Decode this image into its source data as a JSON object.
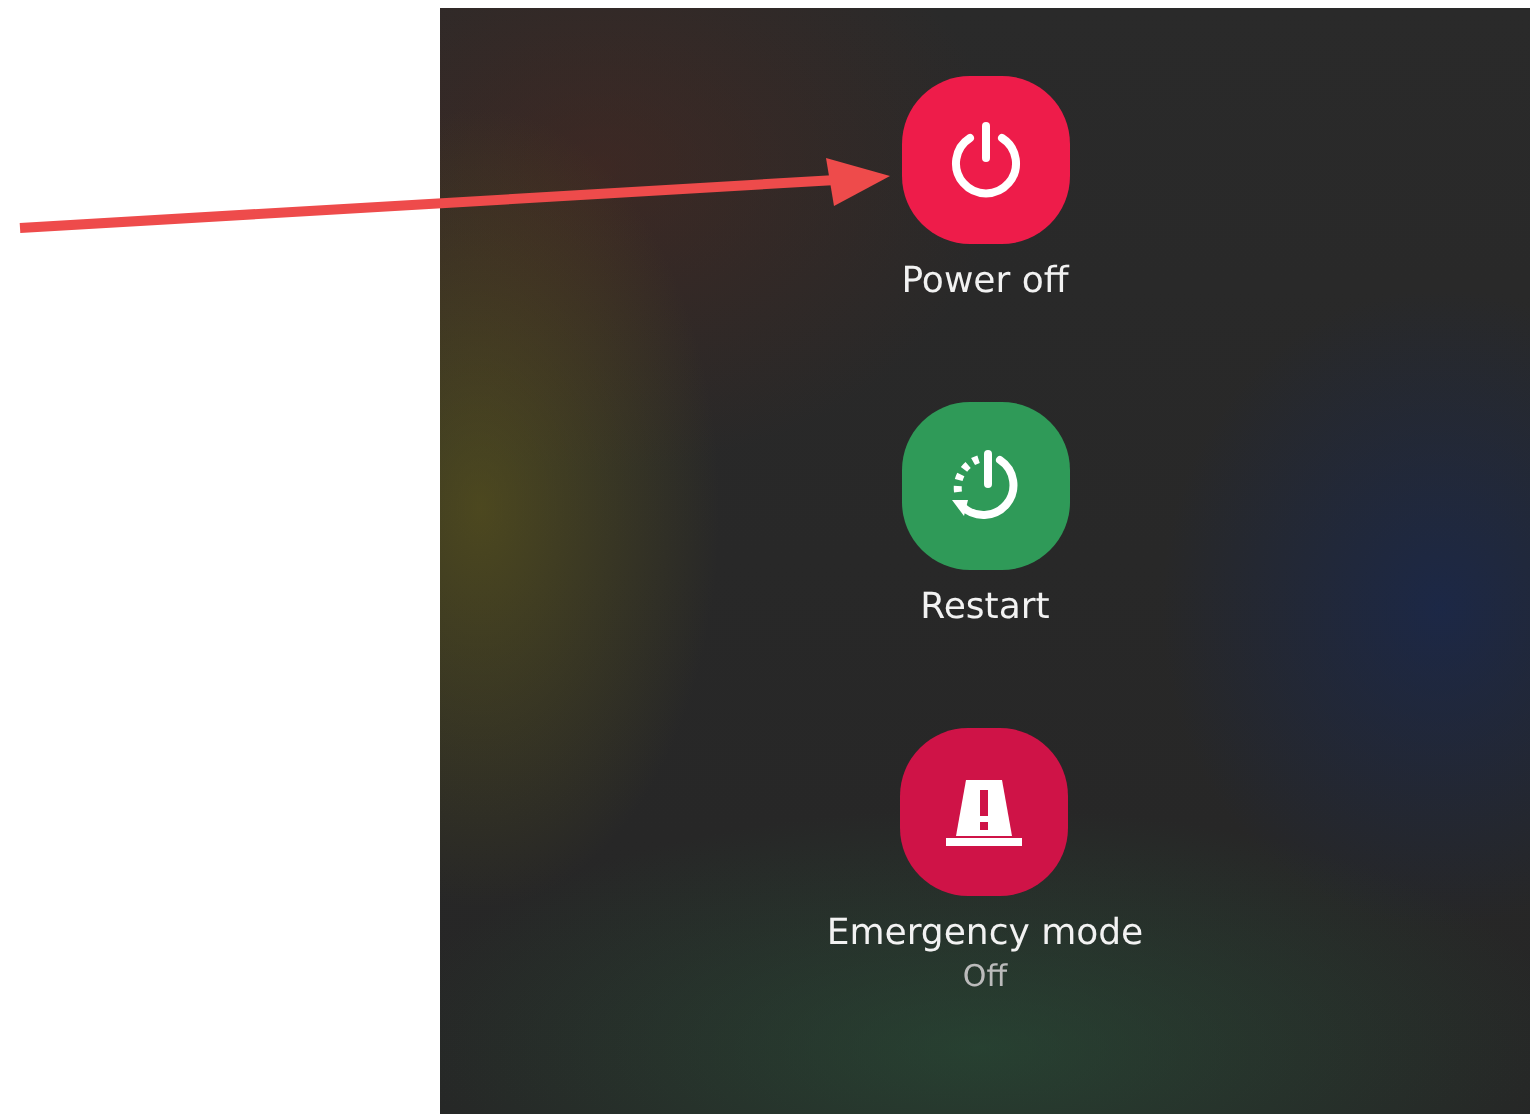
{
  "actions": [
    {
      "kind": "power",
      "label": "Power off",
      "color": "#ee1c4a"
    },
    {
      "kind": "restart",
      "label": "Restart",
      "color": "#2f9a58"
    },
    {
      "kind": "emergency",
      "label": "Emergency mode",
      "status": "Off",
      "color": "#cf1347"
    }
  ]
}
